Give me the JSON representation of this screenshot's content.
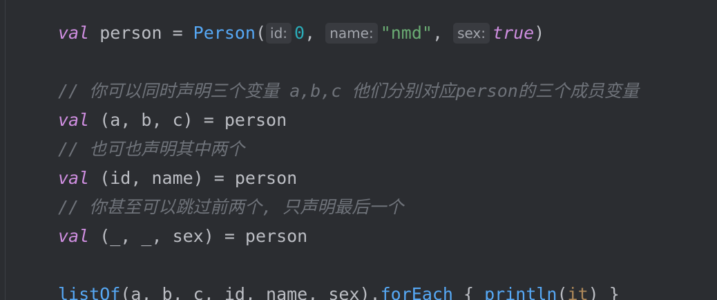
{
  "code": {
    "line1": {
      "kw": "val",
      "var": " person = ",
      "cls": "Person",
      "open": "(",
      "hint_id": "id:",
      "arg_id": "0",
      "sep1": ", ",
      "hint_name": "name:",
      "arg_name": "\"nmd\"",
      "sep2": ", ",
      "hint_sex": "sex:",
      "arg_sex": "true",
      "close": ")"
    },
    "line3": {
      "comment": "// 你可以同时声明三个变量 a,b,c 他们分别对应person的三个成员变量"
    },
    "line4": {
      "kw": "val",
      "rest": " (a, b, c) = person"
    },
    "line5": {
      "comment": "// 也可也声明其中两个"
    },
    "line6": {
      "kw": "val",
      "rest": " (id, name) = person"
    },
    "line7": {
      "comment": "// 你甚至可以跳过前两个, 只声明最后一个"
    },
    "line8": {
      "kw": "val",
      "rest": " (_, _, sex) = person"
    },
    "line10": {
      "fn1": "listOf",
      "args": "(a, b, c, id, name, sex).",
      "fn2": "forEach",
      "brace_open": " { ",
      "fn3": "println",
      "paren_open": "(",
      "it": "it",
      "paren_close": ")",
      "brace_close": " }"
    }
  }
}
